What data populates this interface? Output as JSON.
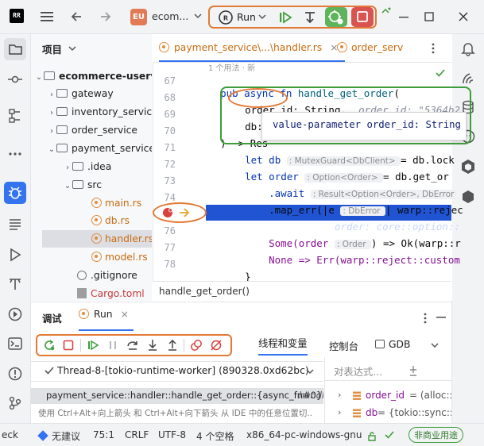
{
  "titlebar": {
    "app_icon_text": "RR",
    "project_badge": "EU",
    "project_name": "ecom...",
    "run_label": "Run"
  },
  "project_pane": {
    "title": "项目",
    "items": [
      {
        "label": "ecommerce-uservic",
        "type": "folder"
      },
      {
        "label": "gateway",
        "type": "folder"
      },
      {
        "label": "inventory_service",
        "type": "folder"
      },
      {
        "label": "order_service",
        "type": "folder"
      },
      {
        "label": "payment_service",
        "type": "folder"
      },
      {
        "label": ".idea",
        "type": "folder"
      },
      {
        "label": "src",
        "type": "folder"
      },
      {
        "label": "main.rs",
        "type": "rust"
      },
      {
        "label": "db.rs",
        "type": "rust"
      },
      {
        "label": "handler.rs",
        "type": "rust"
      },
      {
        "label": "model.rs",
        "type": "rust"
      },
      {
        "label": ".gitignore",
        "type": "file"
      },
      {
        "label": "Cargo.toml",
        "type": "file"
      }
    ]
  },
  "editor": {
    "tabs": [
      {
        "label": "payment_service\\...\\handler.rs"
      },
      {
        "label": "order_serv"
      }
    ],
    "usage_hint": "1 个用法 · 新",
    "lines": {
      "l67": "67",
      "l68": "68",
      "l69": "69",
      "l70": "70",
      "l71": "71",
      "l72": "72",
      "l73": "73",
      "l74": "74",
      "l75": "75",
      "l76": "76",
      "l77": "77",
      "l78": "78"
    },
    "code": {
      "pub": "pub ",
      "async": "async ",
      "fn": "fn ",
      "fn_name": "handle_get_order",
      "paren": "(",
      "order_id": "order_id",
      "string_type": ": String,",
      "order_id_val": "order_id: \"5364b2",
      "db": "db:",
      "ret": ") -> Res",
      "let1": "let db ",
      "mutex_hint": ": MutexGuard<DbClient> ",
      "db_lock": "= db.lock",
      "let2": "let order ",
      "option_hint": ": Option<Order> ",
      "get_ord": "= db.get_or",
      "await": ".await ",
      "result_hint": ": Result<Option<Order>, DbError",
      "map_err": ".map_err(|e ",
      "dberror_hint": ": DbError ",
      "reject": "| warp::rejec",
      "match_line": "match order {",
      "match_dbg": "order: core::option::",
      "some_part": "Some(order ",
      "order_hint": ": Order ",
      "some_rest": ") => Ok(warp::r",
      "none_line": "None => Err(warp::reject::custom",
      "close_brace": "}",
      "close_brace2": "}"
    },
    "tooltip": "value-parameter order_id: String",
    "breadcrumb": "handle_get_order()"
  },
  "debug": {
    "tab_debug": "调试",
    "tab_run": "Run",
    "tab_threads_vars": "线程和变量",
    "tab_console": "控制台",
    "tab_gdb": "GDB",
    "thread_selector": "Thread-8-[tokio-runtime-worker] (890328.0xd62bc)",
    "eval_placeholder": "对表达式...",
    "frame": "payment_service::handler::handle_get_order::{async_fn#0}",
    "frame_file": "handle",
    "hint": "使用 Ctrl+Alt+向上箭头 和 Ctrl+Alt+向下箭头 从 IDE 中的任意位置切...",
    "var1_name": "order_id",
    "var1_value": " = (alloc::st",
    "var2_name": "db",
    "var2_value": " = {tokio::sync::m"
  },
  "statusbar": {
    "left_fragment": "eck",
    "inspection": "无建议",
    "position": "75:1",
    "line_sep": "CRLF",
    "encoding": "UTF-8",
    "indent": "4 个空格",
    "target": "x86_64-pc-windows-gnu",
    "license": "非商业用途"
  },
  "colors": {
    "accent": "#3574f0",
    "orange_highlight": "#e27935",
    "green_highlight": "#3e9d3a",
    "exec_line": "#2154d3",
    "project_badge": "#e27a56"
  }
}
